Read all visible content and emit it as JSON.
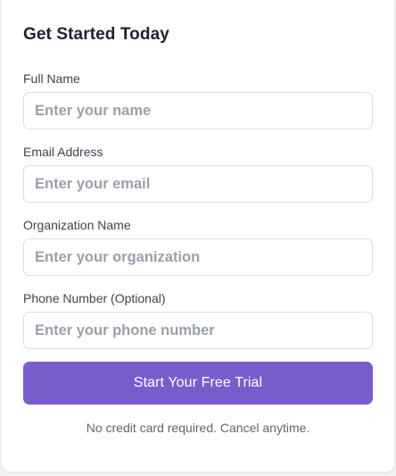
{
  "form": {
    "title": "Get Started Today",
    "fields": [
      {
        "label": "Full Name",
        "placeholder": "Enter your name",
        "value": ""
      },
      {
        "label": "Email Address",
        "placeholder": "Enter your email",
        "value": ""
      },
      {
        "label": "Organization Name",
        "placeholder": "Enter your organization",
        "value": ""
      },
      {
        "label": "Phone Number (Optional)",
        "placeholder": "Enter your phone number",
        "value": ""
      }
    ],
    "submit_label": "Start Your Free Trial",
    "note": "No credit card required. Cancel anytime."
  },
  "colors": {
    "accent": "#7b5ccc",
    "title_text": "#1c2330",
    "label_text": "#3d4452",
    "placeholder_text": "#9aa0aa",
    "note_text": "#5f6572",
    "input_border": "#d9dce1"
  }
}
